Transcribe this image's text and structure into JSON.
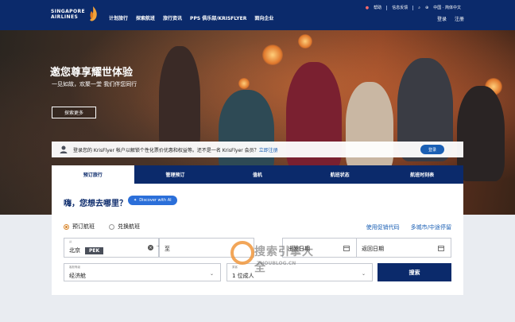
{
  "header": {
    "brand_line1": "SINGAPORE",
    "brand_line2": "AIRLINES",
    "nav": [
      "计划旅行",
      "探索航班",
      "旅行资讯",
      "PPS 俱乐部/KRISFLYER",
      "面向企业"
    ],
    "help": "帮助",
    "feedback": "信息反馈",
    "region": "中国 · 简体中文",
    "login": "登录",
    "signup": "注册"
  },
  "hero": {
    "title": "邀您尊享耀世体验",
    "subtitle": "一见如故，欢聚一堂 我们伴您同行",
    "cta": "探索更多"
  },
  "krisflyer": {
    "message": "登录您的 KrisFlyer 帐户以解锁个性化票价优惠和权益等。还不是一名 KrisFlyer 会员？",
    "signup_link": "立即注册",
    "login_button": "登录"
  },
  "tabs": [
    "预订旅行",
    "管理预订",
    "值机",
    "航班状态",
    "航班时刻表"
  ],
  "booking": {
    "greeting": "嗨，您想去哪里？",
    "ai_button": "Discover with AI",
    "radio_book": "预订航班",
    "radio_redeem": "兑换航班",
    "promo_link": "使用促销代码",
    "multi_link": "多城市/中途停留",
    "from_label": "从",
    "from_city": "北京",
    "from_code": "PEK",
    "to_placeholder": "至",
    "depart_placeholder": "出发日期",
    "return_placeholder": "返回日期",
    "cabin_label": "客舱等级",
    "cabin_value": "经济舱",
    "pax_label": "乘客",
    "pax_value": "1 位成人",
    "search": "搜索"
  },
  "watermark": {
    "title": "搜索引擎大全",
    "url": "ZHOUBLOG.CN"
  }
}
